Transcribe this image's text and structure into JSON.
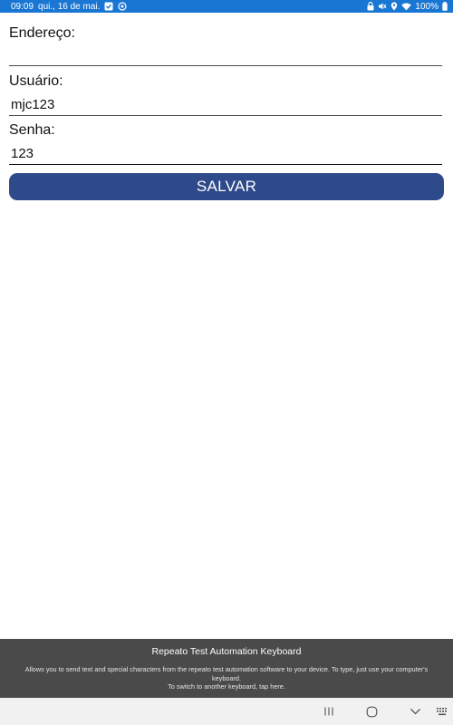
{
  "status_bar": {
    "time": "09:09",
    "date": "qui., 16 de mai.",
    "battery": "100%",
    "bg_color": "#1976d2"
  },
  "form": {
    "address": {
      "label": "Endereço:",
      "value": ""
    },
    "user": {
      "label": "Usuário:",
      "value": "mjc123"
    },
    "password": {
      "label": "Senha:",
      "value": "123"
    },
    "save_label": "SALVAR",
    "button_color": "#2f4a8a"
  },
  "keyboard_panel": {
    "title": "Repeato Test Automation Keyboard",
    "description": "Allows you to send text and special characters from the repeato test automation software to your device. To type, just use your computer's keyboard.",
    "switch_hint": "To switch to another keyboard, tap here.",
    "bg_color": "#4a4a4a"
  },
  "nav_bar": {
    "icons": [
      "recent-apps-icon",
      "home-icon",
      "back-icon",
      "keyboard-icon"
    ]
  }
}
